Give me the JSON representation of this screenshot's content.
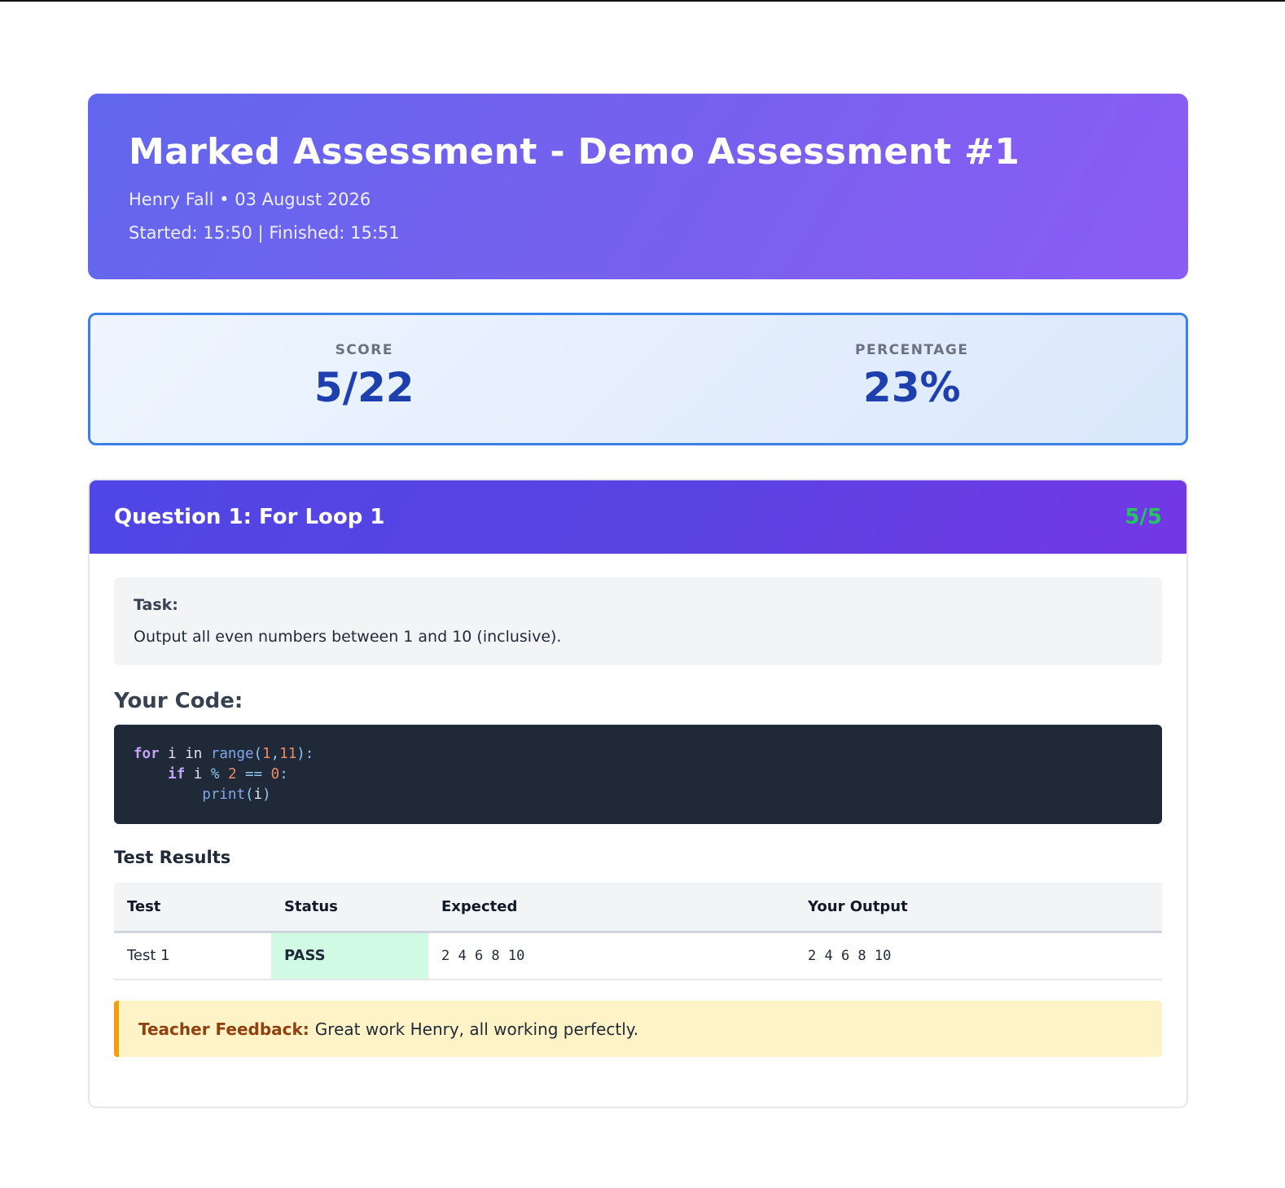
{
  "header": {
    "title": "Marked Assessment - Demo Assessment #1",
    "student_name": "Henry Fall",
    "separator": "•",
    "date": "03 August 2026",
    "started_label": "Started:",
    "started_time": "15:50",
    "divider": "|",
    "finished_label": "Finished:",
    "finished_time": "15:51"
  },
  "summary": {
    "score_label": "SCORE",
    "score_value": "5/22",
    "percentage_label": "PERCENTAGE",
    "percentage_value": "23%"
  },
  "questions": [
    {
      "title": "Question 1: For Loop 1",
      "score": "5/5",
      "task_label": "Task:",
      "task_text": "Output all even numbers between 1 and 10 (inclusive).",
      "code_heading": "Your Code:",
      "code_lines": [
        "for i in range(1,11):",
        "    if i % 2 == 0:",
        "        print(i)"
      ],
      "results_heading": "Test Results",
      "results_columns": [
        "Test",
        "Status",
        "Expected",
        "Your Output"
      ],
      "results_rows": [
        {
          "test": "Test 1",
          "status": "PASS",
          "expected": "2 4 6 8 10",
          "output": "2 4 6 8 10"
        }
      ],
      "feedback_label": "Teacher Feedback:",
      "feedback_text": "Great work Henry, all working perfectly."
    }
  ],
  "colors": {
    "header_gradient_start": "#6366f1",
    "header_gradient_end": "#8b5cf6",
    "score_accent": "#1e40af",
    "pass_background": "#d1fae5",
    "question_score": "#22c55e",
    "feedback_accent": "#f59e0b"
  }
}
